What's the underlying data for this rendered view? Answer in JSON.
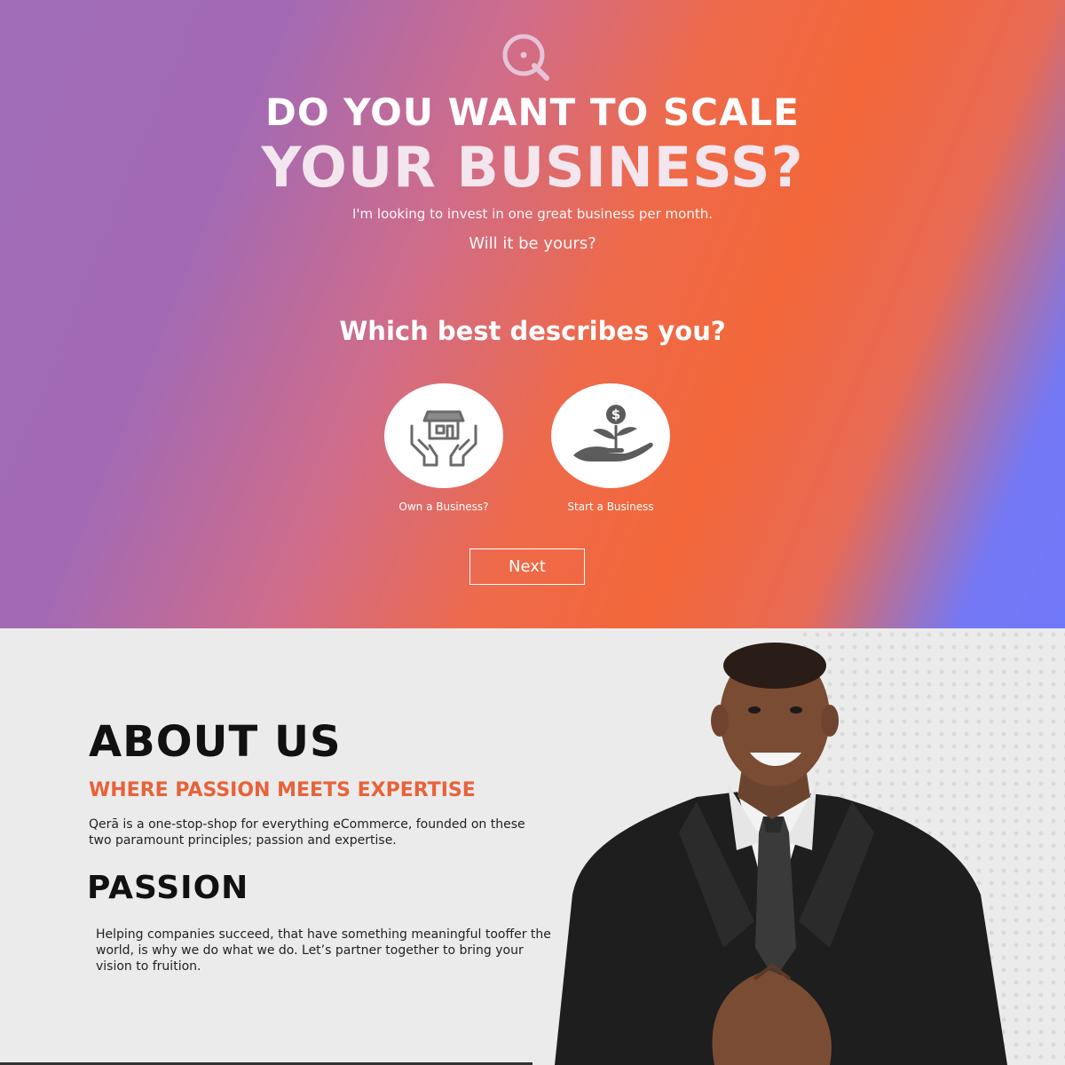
{
  "hero": {
    "logo_icon": "q-logo-icon",
    "headline_line1": "DO YOU WANT TO SCALE",
    "headline_line2": "YOUR BUSINESS?",
    "subtitle": "I'm looking to invest in one great business per month.",
    "subtitle2": "Will it be yours?",
    "question": "Which best describes you?",
    "options": [
      {
        "label": "Own a Business?",
        "icon": "store-in-hands-icon"
      },
      {
        "label": "Start a Business",
        "icon": "money-plant-hand-icon"
      }
    ],
    "next_label": "Next"
  },
  "about": {
    "title": "ABOUT US",
    "tagline": "WHERE PASSION MEETS EXPERTISE",
    "description": "Qerā is a one-stop-shop for everything eCommerce, founded on these two paramount principles; passion and expertise.",
    "passion_title": "PASSION",
    "passion_text": "Helping companies succeed, that have something meaningful tooffer the world, is why we do what we do. Let’s partner together to bring your vision to fruition.",
    "accent_color": "#e8623a"
  },
  "colors": {
    "gradient_purple": "#a06cb8",
    "gradient_orange": "#f3673a",
    "gradient_blue": "#6f78f8"
  }
}
